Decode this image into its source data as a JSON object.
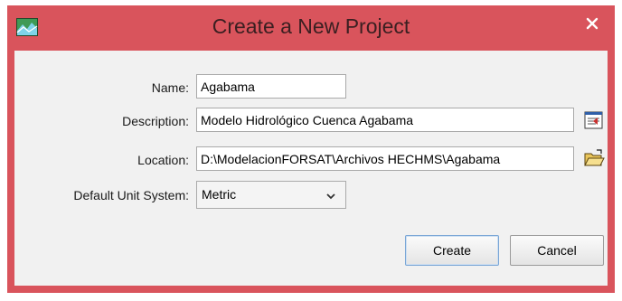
{
  "window": {
    "title": "Create a New Project",
    "close_symbol": "×"
  },
  "form": {
    "name_label": "Name:",
    "name_value": "Agabama",
    "description_label": "Description:",
    "description_value": "Modelo Hidrológico Cuenca Agabama",
    "location_label": "Location:",
    "location_value": "D:\\ModelacionFORSAT\\Archivos HECHMS\\Agabama",
    "unit_label": "Default Unit System:",
    "unit_value": "Metric"
  },
  "buttons": {
    "create_label": "Create",
    "cancel_label": "Cancel"
  },
  "colors": {
    "titlebar": "#d9545c",
    "client": "#f1f1f1",
    "default_button_border": "#7aa6d6"
  },
  "icons": [
    "app-map-icon",
    "close-icon",
    "description-editor-icon",
    "folder-open-icon",
    "chevron-down-icon"
  ]
}
